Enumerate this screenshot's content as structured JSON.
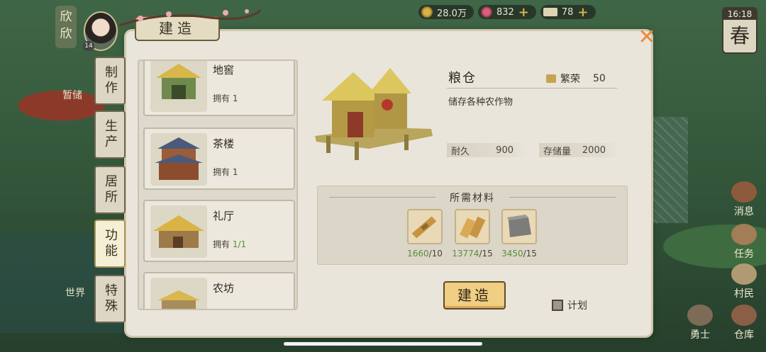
{
  "topbar": {
    "coins": "28.0万",
    "flowers": "832",
    "tickets": "78"
  },
  "player": {
    "name": "欣欣",
    "level": "14"
  },
  "clock": {
    "time": "16:18",
    "season": "春"
  },
  "panel": {
    "title": "建造"
  },
  "tabs": [
    {
      "label": "制作",
      "active": false
    },
    {
      "label": "生产",
      "active": false
    },
    {
      "label": "居所",
      "active": false
    },
    {
      "label": "功能",
      "active": true
    },
    {
      "label": "特殊",
      "active": false
    }
  ],
  "buildings": [
    {
      "name": "地窖",
      "owned_label": "拥有",
      "owned": "1"
    },
    {
      "name": "茶楼",
      "owned_label": "拥有",
      "owned": "1"
    },
    {
      "name": "礼厅",
      "owned_label": "拥有",
      "owned": "1/1"
    },
    {
      "name": "农坊",
      "owned_label": "",
      "owned": ""
    }
  ],
  "detail": {
    "name": "粮仓",
    "prosperity_label": "繁荣",
    "prosperity": "50",
    "description": "储存各种农作物",
    "durability_label": "耐久",
    "durability": "900",
    "storage_label": "存储量",
    "storage": "2000"
  },
  "materials": {
    "title": "所需材料",
    "items": [
      {
        "name": "straw-bundle",
        "have": "1660",
        "need": "/10"
      },
      {
        "name": "wood-planks",
        "have": "13774",
        "need": "/15"
      },
      {
        "name": "stone-block",
        "have": "3450",
        "need": "/15"
      }
    ]
  },
  "actions": {
    "build_label": "建造",
    "plan_label": "计划"
  },
  "side_menu": {
    "quests": "任务",
    "villagers": "村民",
    "warriors": "勇士",
    "warehouse": "仓库",
    "news": "消息"
  },
  "background_labels": {
    "wardrobe_left": "暂储",
    "world": "世界",
    "build_bottom": "建造"
  }
}
